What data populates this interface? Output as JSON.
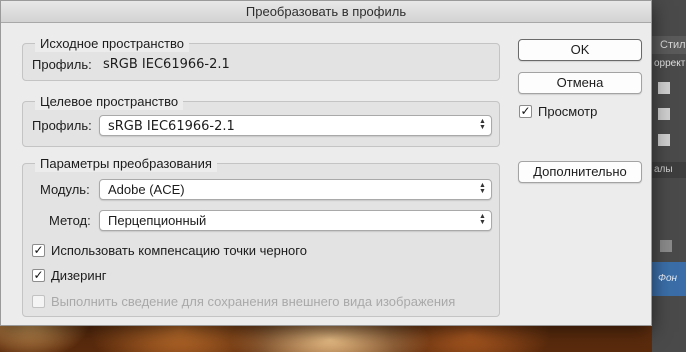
{
  "dialog": {
    "title": "Преобразовать в профиль",
    "source": {
      "legend": "Исходное пространство",
      "profile_label": "Профиль:",
      "profile_value": "sRGB IEC61966-2.1"
    },
    "target": {
      "legend": "Целевое пространство",
      "profile_label": "Профиль:",
      "profile_selected": "sRGB IEC61966-2.1"
    },
    "conversion": {
      "legend": "Параметры преобразования",
      "engine_label": "Модуль:",
      "engine_selected": "Adobe (ACE)",
      "intent_label": "Метод:",
      "intent_selected": "Перцепционный",
      "checkboxes": [
        {
          "label": "Использовать компенсацию точки черного",
          "checked": true,
          "enabled": true
        },
        {
          "label": "Дизеринг",
          "checked": true,
          "enabled": true
        },
        {
          "label": "Выполнить сведение для сохранения внешнего вида изображения",
          "checked": false,
          "enabled": false
        }
      ]
    },
    "buttons": {
      "ok": "OK",
      "cancel": "Отмена",
      "advanced": "Дополнительно"
    },
    "preview": {
      "label": "Просмотр",
      "checked": true
    },
    "checkmark_glyph": "✓"
  },
  "background": {
    "panel_tab_1": "Стил",
    "panel_tab_2": "оррект",
    "panel_tab_3": "алы",
    "layer_label": "Фон"
  }
}
